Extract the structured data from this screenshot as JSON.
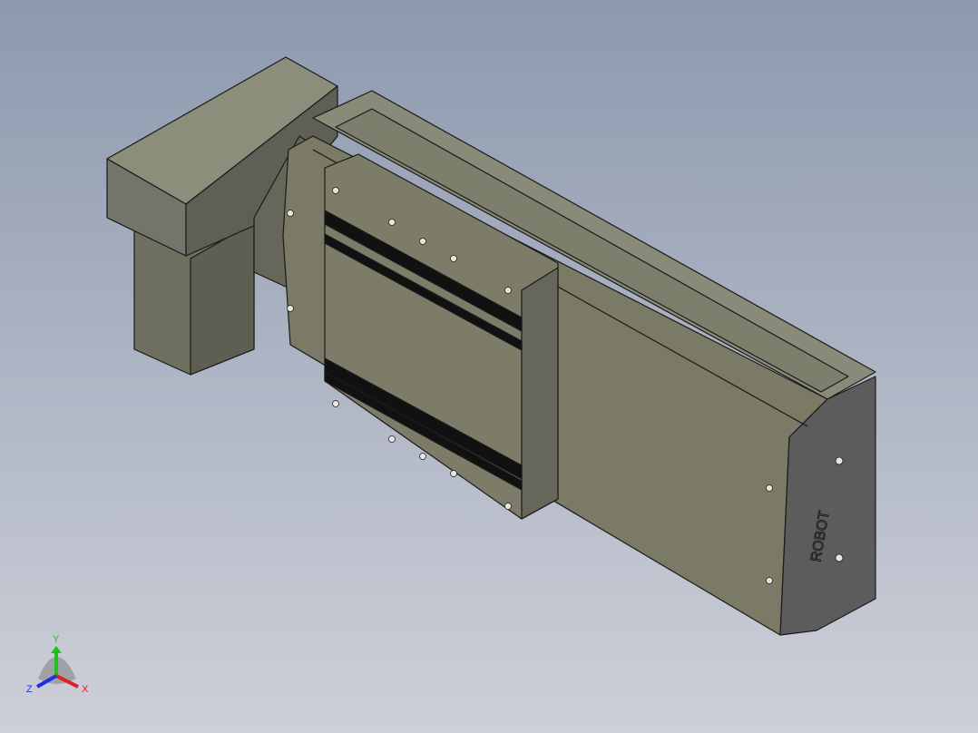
{
  "model": {
    "logo_text": "ROBOT",
    "colors": {
      "body": "#7b7b68",
      "body_top": "#8e8e7c",
      "end_cap": "#5c5c5c",
      "stripe": "#111111",
      "edge": "#1a1a1a"
    }
  },
  "triad": {
    "x_label": "X",
    "y_label": "Y",
    "z_label": "Z",
    "x_color": "#e02020",
    "y_color": "#20c020",
    "z_color": "#2030e0"
  }
}
